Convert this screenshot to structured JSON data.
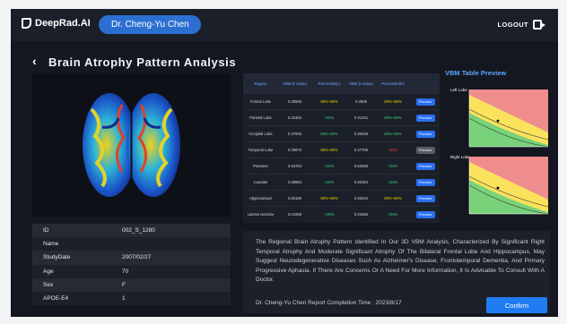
{
  "app": {
    "brand": "DeepRad.AI",
    "user": "Dr. Cheng-Yu Chen",
    "logout_label": "LOGOUT"
  },
  "page": {
    "title": "Brain Atrophy Pattern Analysis",
    "back_icon": "chevron-left-icon"
  },
  "patient_info": [
    {
      "key": "ID",
      "value": "002_S_1280"
    },
    {
      "key": "Name",
      "value": ""
    },
    {
      "key": "StudyDate",
      "value": "2007/02/27"
    },
    {
      "key": "Age",
      "value": "70"
    },
    {
      "key": "Sex",
      "value": "F"
    },
    {
      "key": "APOE-E4",
      "value": "1"
    }
  ],
  "vbm_table": {
    "headers": {
      "region": "Region",
      "vbm_l": "VBM (t-value)",
      "pct_l": "Percentile(L)",
      "vbm_r": "VBM (t-value)",
      "pct_r": "Percentile(R)",
      "preview": ""
    },
    "rows": [
      {
        "region": "Frontal Lobe",
        "vbm_l": "0.28586",
        "pct_l": "60%~80%",
        "vbm_r": "0.2909",
        "pct_r": "60%~80%",
        "preview": "Preview",
        "pct_l_color": "#f5d300",
        "pct_r_color": "#f5d300",
        "muted": false
      },
      {
        "region": "Parietal Lobe",
        "vbm_l": "0.32464",
        "pct_l": ">40%",
        "vbm_r": "0.31241",
        "pct_r": "60%~80%",
        "preview": "Preview",
        "pct_l_color": "#3fd17f",
        "pct_r_color": "#3fd17f",
        "muted": false
      },
      {
        "region": "Occipital Lobe",
        "vbm_l": "0.37605",
        "pct_l": "60%~80%",
        "vbm_r": "0.36336",
        "pct_r": "60%~80%",
        "preview": "Preview",
        "pct_l_color": "#3fd17f",
        "pct_r_color": "#3fd17f",
        "muted": false
      },
      {
        "region": "Temporal Lobe",
        "vbm_l": "0.39873",
        "pct_l": "60%~80%",
        "vbm_r": "0.37765",
        "pct_r": "<20%",
        "preview": "Preview",
        "pct_l_color": "#f5d300",
        "pct_r_color": "#ff3b3b",
        "muted": true
      },
      {
        "region": "Putamen",
        "vbm_l": "0.53784",
        "pct_l": ">40%",
        "vbm_r": "0.52898",
        "pct_r": ">40%",
        "preview": "Preview",
        "pct_l_color": "#3fd17f",
        "pct_r_color": "#3fd17f",
        "muted": false
      },
      {
        "region": "Caudate",
        "vbm_l": "0.58884",
        "pct_l": ">40%",
        "vbm_r": "0.60354",
        "pct_r": ">40%",
        "preview": "Preview",
        "pct_l_color": "#3fd17f",
        "pct_r_color": "#3fd17f",
        "muted": false
      },
      {
        "region": "Hippocampus",
        "vbm_l": "0.56185",
        "pct_l": "60%~80%",
        "vbm_r": "0.56432",
        "pct_r": "60%~80%",
        "preview": "Preview",
        "pct_l_color": "#f5d300",
        "pct_r_color": "#f5d300",
        "muted": false
      },
      {
        "region": "Lateral ventricle",
        "vbm_l": "0.01908",
        "pct_l": ">40%",
        "vbm_r": "0.02866",
        "pct_r": ">40%",
        "preview": "Preview",
        "pct_l_color": "#3fd17f",
        "pct_r_color": "#3fd17f",
        "muted": false
      }
    ]
  },
  "preview": {
    "title": "VBM Table Preview",
    "left_label": "Left Lobe",
    "right_label": "Right Lobe"
  },
  "report": {
    "text": "The Regional Brain Atrophy Pattern Identified In Our 3D VBM Analysis, Characterized By Significant Right Temporal Atrophy And Moderate Significant Atrophy Of The Bilateral Frontal Lobe And Hippocampus, May Suggest Neurodegenerative Diseases Such As Alzheimer's Disease, Frontotemporal Dementia, And Primary Progressive Aphasia. If There Are Concerns Or A Need For More Information, It Is Advisable To Consult With A Doctor.",
    "footer": "Dr. Cheng-Yu Chen  Report Completion Time : 2023/8/17",
    "confirm_label": "Confirm"
  }
}
